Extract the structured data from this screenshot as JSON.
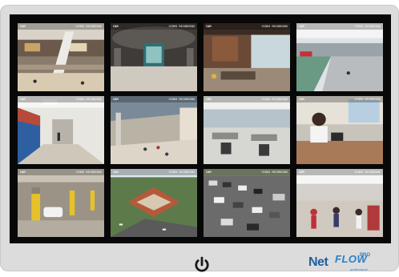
{
  "colors": {
    "bezel": "#dcdcdc",
    "screen": "#080808",
    "brand": "#1e5fa0"
  },
  "osd": {
    "camera_label": "CAM",
    "status_text": "VIDEO RECORDING"
  },
  "feeds": [
    {
      "name": "mall-atrium"
    },
    {
      "name": "station-concourse"
    },
    {
      "name": "lobby-reception"
    },
    {
      "name": "train-platform"
    },
    {
      "name": "school-hallway"
    },
    {
      "name": "mall-food-court"
    },
    {
      "name": "open-office"
    },
    {
      "name": "pharmacy-counter"
    },
    {
      "name": "parking-garage"
    },
    {
      "name": "aerial-building"
    },
    {
      "name": "parking-lot"
    },
    {
      "name": "retail-store"
    }
  ],
  "controls": {
    "power_icon": "power-icon"
  },
  "brand": {
    "net": "Net",
    "flow": "FLOW",
    "pro": "PRO",
    "sub": "professional"
  }
}
